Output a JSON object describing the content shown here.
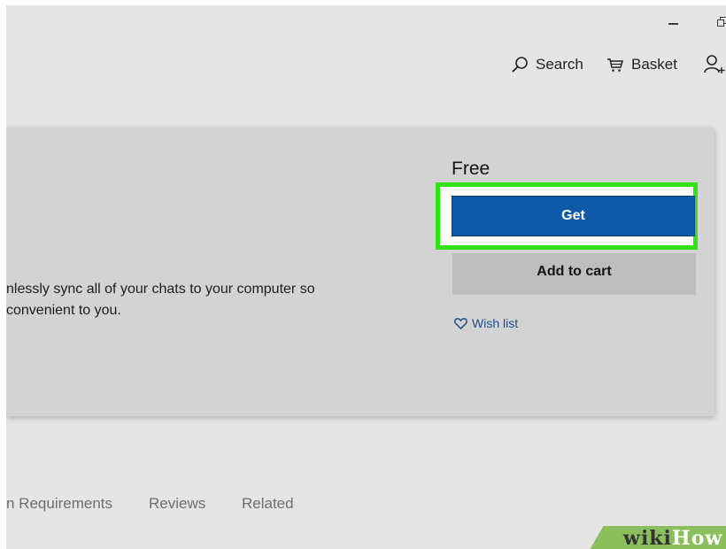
{
  "header": {
    "search_label": "Search",
    "basket_label": "Basket"
  },
  "product": {
    "description_line1": "nlessly sync all of your chats to your computer so",
    "description_line2": "convenient to you.",
    "price": "Free",
    "get_label": "Get",
    "add_to_cart_label": "Add to cart",
    "wish_list_label": "Wish list"
  },
  "tabs": [
    {
      "label": "n Requirements"
    },
    {
      "label": "Reviews"
    },
    {
      "label": "Related"
    }
  ],
  "watermark": {
    "part1": "wiki",
    "part2": "How"
  },
  "colors": {
    "get_button": "#0f5aa8",
    "highlight": "#33e019",
    "wish_link": "#1b4f8f"
  },
  "icons": [
    "minimize-icon",
    "restore-icon",
    "search-icon",
    "basket-icon",
    "account-icon",
    "heart-icon"
  ]
}
